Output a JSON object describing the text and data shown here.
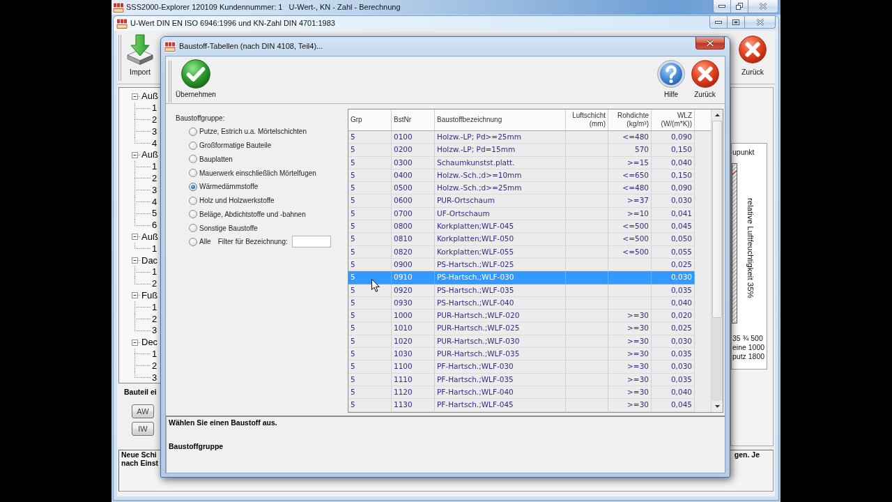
{
  "outer_window": {
    "title": "SSS2000-Explorer 120109 Kundennummer: 1   U-Wert-, KN - Zahl - Berechnung"
  },
  "inner_window": {
    "title": "U-Wert DIN EN ISO 6946:1996 und KN-Zahl DIN 4701:1983",
    "toolbar": [
      {
        "kind": "import",
        "label": "Import"
      },
      {
        "kind": "back",
        "label": "Zurück"
      }
    ],
    "tree": [
      {
        "label": "Auß",
        "expanded": true,
        "children": [
          {
            "label": "1"
          },
          {
            "label": "2"
          },
          {
            "label": "3"
          },
          {
            "label": "4"
          }
        ]
      },
      {
        "label": "Auß",
        "expanded": true,
        "children": [
          {
            "label": "1"
          },
          {
            "label": "2"
          },
          {
            "label": "3"
          },
          {
            "label": "4"
          },
          {
            "label": "5"
          },
          {
            "label": "6"
          }
        ]
      },
      {
        "label": "Auß",
        "expanded": true,
        "children": [
          {
            "label": "1"
          }
        ]
      },
      {
        "label": "Dac",
        "expanded": true,
        "children": [
          {
            "label": "1"
          },
          {
            "label": "2"
          }
        ]
      },
      {
        "label": "Fuß",
        "expanded": true,
        "children": [
          {
            "label": "1"
          },
          {
            "label": "2"
          },
          {
            "label": "3"
          }
        ]
      },
      {
        "label": "Dec",
        "expanded": true,
        "children": [
          {
            "label": "1"
          },
          {
            "label": "2"
          },
          {
            "label": "3"
          }
        ]
      }
    ],
    "section_label": "Bauteil ei",
    "buttons": [
      "AW",
      "IW"
    ],
    "chart_panel": {
      "title": "upunkt",
      "axis_label": "relative Luftfeuchtigkeit 35%",
      "legend": [
        "35 ¾ 500",
        "eine 1000",
        "putz 1800"
      ]
    },
    "message": {
      "left_lines": [
        "Neue Schi",
        "nach Einst"
      ],
      "right_text": "gen. Je"
    }
  },
  "dialog": {
    "title": "Baustoff-Tabellen (nach DIN 4108, Teil4)...",
    "toolbar": [
      {
        "kind": "accept",
        "label": "Übernehmen"
      },
      {
        "kind": "help",
        "label": "Hilfe"
      },
      {
        "kind": "back",
        "label": "Zurück"
      }
    ],
    "group_label": "Baustoffgruppe:",
    "groups": [
      {
        "label": "Putze, Estrich u.a. Mörtelschichten",
        "selected": false
      },
      {
        "label": "Großformatige Bauteile",
        "selected": false
      },
      {
        "label": "Bauplatten",
        "selected": false
      },
      {
        "label": "Mauerwerk einschließlich Mörtelfugen",
        "selected": false
      },
      {
        "label": "Wärmedämmstoffe",
        "selected": true
      },
      {
        "label": "Holz und Holzwerkstoffe",
        "selected": false
      },
      {
        "label": "Beläge, Abdichtstoffe und -bahnen",
        "selected": false
      },
      {
        "label": "Sonstige Baustoffe",
        "selected": false
      },
      {
        "label": "Alle",
        "selected": false
      }
    ],
    "filter": {
      "label": "Filter für Bezeichnung:"
    },
    "table": {
      "columns": [
        {
          "label": "Grp",
          "kind": "text"
        },
        {
          "label": "BstNr",
          "kind": "text"
        },
        {
          "label": "Baustoffbezeichnung",
          "kind": "text"
        },
        {
          "label": "Luftschicht",
          "unit": "(mm)",
          "kind": "number"
        },
        {
          "label": "Rohdichte",
          "unit": "(kg/m³)",
          "kind": "number"
        },
        {
          "label": "WLZ",
          "unit": "(W/(m*K))",
          "kind": "number"
        }
      ],
      "rows": [
        {
          "grp": "5",
          "bstnr": "0100",
          "name": "Holzw.-LP; Pd>=25mm",
          "density": "<=480",
          "wlz": "0,090",
          "selected": false
        },
        {
          "grp": "5",
          "bstnr": "0200",
          "name": "Holzw.-LP; Pd=15mm",
          "density": "570",
          "wlz": "0,150",
          "selected": false
        },
        {
          "grp": "5",
          "bstnr": "0300",
          "name": "Schaumkunstst.platt.",
          "density": ">=15",
          "wlz": "0,040",
          "selected": false
        },
        {
          "grp": "5",
          "bstnr": "0400",
          "name": "Holzw.-Sch.;d>=10mm",
          "density": "<=650",
          "wlz": "0,150",
          "selected": false
        },
        {
          "grp": "5",
          "bstnr": "0500",
          "name": "Holzw.-Sch.;d>=25mm",
          "density": "<=480",
          "wlz": "0,090",
          "selected": false
        },
        {
          "grp": "5",
          "bstnr": "0600",
          "name": "PUR-Ortschaum",
          "density": ">=37",
          "wlz": "0,030",
          "selected": false
        },
        {
          "grp": "5",
          "bstnr": "0700",
          "name": "UF-Ortschaum",
          "density": ">=10",
          "wlz": "0,041",
          "selected": false
        },
        {
          "grp": "5",
          "bstnr": "0800",
          "name": "Korkplatten;WLF-045",
          "density": "<=500",
          "wlz": "0,045",
          "selected": false
        },
        {
          "grp": "5",
          "bstnr": "0810",
          "name": "Korkplatten;WLF-050",
          "density": "<=500",
          "wlz": "0,050",
          "selected": false
        },
        {
          "grp": "5",
          "bstnr": "0820",
          "name": "Korkplatten;WLF-055",
          "density": "<=500",
          "wlz": "0,055",
          "selected": false
        },
        {
          "grp": "5",
          "bstnr": "0900",
          "name": "PS-Hartsch.;WLF-025",
          "wlz": "0,025",
          "selected": false
        },
        {
          "grp": "5",
          "bstnr": "0910",
          "name": "PS-Hartsch.;WLF-030",
          "wlz": "0,030",
          "selected": true
        },
        {
          "grp": "5",
          "bstnr": "0920",
          "name": "PS-Hartsch.;WLF-035",
          "wlz": "0,035",
          "selected": false
        },
        {
          "grp": "5",
          "bstnr": "0930",
          "name": "PS-Hartsch.;WLF-040",
          "wlz": "0,040",
          "selected": false
        },
        {
          "grp": "5",
          "bstnr": "1000",
          "name": "PUR-Hartsch.;WLF-020",
          "density": ">=30",
          "wlz": "0,020",
          "selected": false
        },
        {
          "grp": "5",
          "bstnr": "1010",
          "name": "PUR-Hartsch.;WLF-025",
          "density": ">=30",
          "wlz": "0,025",
          "selected": false
        },
        {
          "grp": "5",
          "bstnr": "1020",
          "name": "PUR-Hartsch.;WLF-030",
          "density": ">=30",
          "wlz": "0,030",
          "selected": false
        },
        {
          "grp": "5",
          "bstnr": "1030",
          "name": "PUR-Hartsch.;WLF-035",
          "density": ">=30",
          "wlz": "0,035",
          "selected": false
        },
        {
          "grp": "5",
          "bstnr": "1100",
          "name": "PF-Hartsch.;WLF-030",
          "density": ">=30",
          "wlz": "0,030",
          "selected": false
        },
        {
          "grp": "5",
          "bstnr": "1110",
          "name": "PF-Hartsch.;WLF-035",
          "density": ">=30",
          "wlz": "0,035",
          "selected": false
        },
        {
          "grp": "5",
          "bstnr": "1120",
          "name": "PF-Hartsch.;WLF-040",
          "density": ">=30",
          "wlz": "0,040",
          "selected": false
        },
        {
          "grp": "5",
          "bstnr": "1130",
          "name": "PF-Hartsch.;WLF-045",
          "density": ">=30",
          "wlz": "0,045",
          "selected": false
        }
      ]
    },
    "status": [
      "Wählen Sie einen Baustoff aus.",
      "Baustoffgruppe"
    ]
  }
}
